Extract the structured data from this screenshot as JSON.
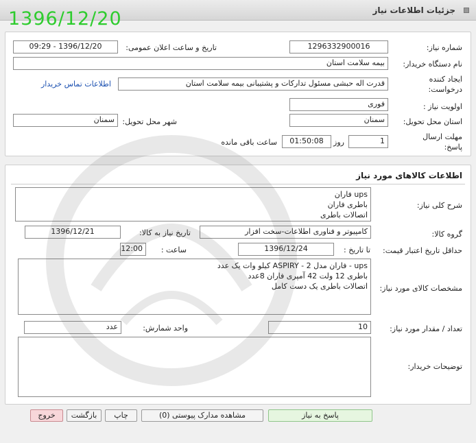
{
  "header": {
    "title": "جزئیات اطلاعات نیاز",
    "date_stamp": "1396/12/20"
  },
  "info": {
    "need_number_label": "شماره نیاز:",
    "need_number": "1296332900016",
    "announce_label": "تاریخ و ساعت اعلان عمومی:",
    "announce_value": "1396/12/20 - 09:29",
    "buyer_org_label": "نام دستگاه خریدار:",
    "buyer_org": "بیمه سلامت استان",
    "creator_label_1": "ایجاد کننده",
    "creator_label_2": "درخواست:",
    "creator": "قدرت اله حبشی مسئول تداركات و پشتیبانی بیمه سلامت استان",
    "contact_link": "اطلاعات تماس خریدار",
    "priority_label": "اولویت نیاز :",
    "priority": "فوری",
    "province_label": "استان محل تحویل:",
    "province": "سمنان",
    "city_label": "شهر محل تحویل:",
    "city": "سمنان",
    "deadline_label_1": "مهلت ارسال",
    "deadline_label_2": "پاسخ:",
    "days": "1",
    "days_label": "روز و",
    "time": "01:50:08",
    "remaining_label": "ساعت باقی مانده"
  },
  "goods": {
    "section_title": "اطلاعات کالاهای مورد نیاز",
    "summary_label": "شرح کلی نیاز:",
    "summary": "ups فاران\nباطری فاران\nاتصالات باطری",
    "group_label": "گروه کالا:",
    "group": "کامپیوتر و فناوری اطلاعات-سخت افزار",
    "need_date_label": "تاریخ نیاز به کالا:",
    "need_date": "1396/12/21",
    "min_price_label": "حداقل تاریخ اعتبار قیمت:",
    "until_date_label": "تا تاریخ :",
    "until_date": "1396/12/24",
    "hour_label": "ساعت :",
    "hour": "12:00",
    "specs_label": "مشخصات کالای مورد نیاز:",
    "specs": "ups - فاران مدل ASPIRY - 2 کیلو وات  یک عدد\nباطری 12 ولت 42 آمپری فاران     8عدد\nاتصالات باطری   یک دست کامل",
    "qty_label": "تعداد / مقدار مورد نیاز:",
    "qty": "10",
    "unit_label": "واحد شمارش:",
    "unit": "عدد",
    "notes_label": "توضیحات خریدار:",
    "notes": ""
  },
  "buttons": {
    "reply": "پاسخ به نیاز",
    "attachments": "مشاهده مدارک پیوستی (0)",
    "print": "چاپ",
    "back": "بازگشت",
    "exit": "خروج"
  },
  "colors": {
    "date_stamp": "#2ecc2e",
    "link": "#1a4fb0",
    "exit_bg": "#f8d7da",
    "reply_bg": "#e6f6e0"
  }
}
